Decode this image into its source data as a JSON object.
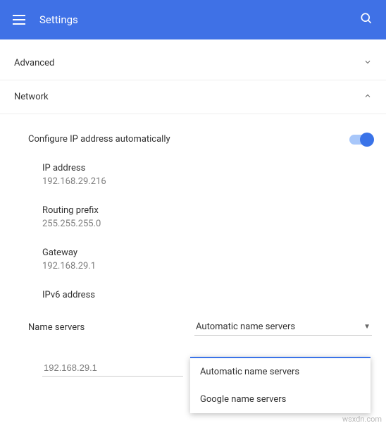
{
  "header": {
    "title": "Settings"
  },
  "sections": {
    "advanced_label": "Advanced",
    "network_label": "Network"
  },
  "network": {
    "auto_ip_label": "Configure IP address automatically",
    "auto_ip_enabled": true,
    "ip": {
      "label": "IP address",
      "value": "192.168.29.216"
    },
    "prefix": {
      "label": "Routing prefix",
      "value": "255.255.255.0"
    },
    "gateway": {
      "label": "Gateway",
      "value": "192.168.29.1"
    },
    "ipv6": {
      "label": "IPv6 address",
      "value": ""
    },
    "nameservers": {
      "label": "Name servers",
      "selected": "Automatic name servers",
      "options": [
        "Automatic name servers",
        "Google name servers"
      ],
      "dns_value": "192.168.29.1"
    }
  },
  "watermark": "wsxdn.com"
}
